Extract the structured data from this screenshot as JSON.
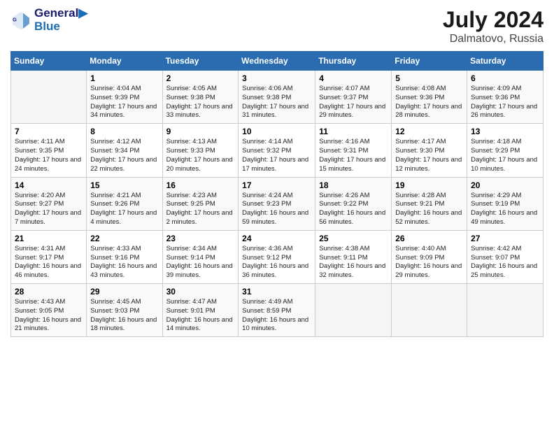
{
  "logo": {
    "line1": "General",
    "line2": "Blue"
  },
  "title": {
    "month_year": "July 2024",
    "location": "Dalmatovo, Russia"
  },
  "header_days": [
    "Sunday",
    "Monday",
    "Tuesday",
    "Wednesday",
    "Thursday",
    "Friday",
    "Saturday"
  ],
  "weeks": [
    [
      {
        "day": "",
        "info": ""
      },
      {
        "day": "1",
        "info": "Sunrise: 4:04 AM\nSunset: 9:39 PM\nDaylight: 17 hours and 34 minutes."
      },
      {
        "day": "2",
        "info": "Sunrise: 4:05 AM\nSunset: 9:38 PM\nDaylight: 17 hours and 33 minutes."
      },
      {
        "day": "3",
        "info": "Sunrise: 4:06 AM\nSunset: 9:38 PM\nDaylight: 17 hours and 31 minutes."
      },
      {
        "day": "4",
        "info": "Sunrise: 4:07 AM\nSunset: 9:37 PM\nDaylight: 17 hours and 29 minutes."
      },
      {
        "day": "5",
        "info": "Sunrise: 4:08 AM\nSunset: 9:36 PM\nDaylight: 17 hours and 28 minutes."
      },
      {
        "day": "6",
        "info": "Sunrise: 4:09 AM\nSunset: 9:36 PM\nDaylight: 17 hours and 26 minutes."
      }
    ],
    [
      {
        "day": "7",
        "info": "Sunrise: 4:11 AM\nSunset: 9:35 PM\nDaylight: 17 hours and 24 minutes."
      },
      {
        "day": "8",
        "info": "Sunrise: 4:12 AM\nSunset: 9:34 PM\nDaylight: 17 hours and 22 minutes."
      },
      {
        "day": "9",
        "info": "Sunrise: 4:13 AM\nSunset: 9:33 PM\nDaylight: 17 hours and 20 minutes."
      },
      {
        "day": "10",
        "info": "Sunrise: 4:14 AM\nSunset: 9:32 PM\nDaylight: 17 hours and 17 minutes."
      },
      {
        "day": "11",
        "info": "Sunrise: 4:16 AM\nSunset: 9:31 PM\nDaylight: 17 hours and 15 minutes."
      },
      {
        "day": "12",
        "info": "Sunrise: 4:17 AM\nSunset: 9:30 PM\nDaylight: 17 hours and 12 minutes."
      },
      {
        "day": "13",
        "info": "Sunrise: 4:18 AM\nSunset: 9:29 PM\nDaylight: 17 hours and 10 minutes."
      }
    ],
    [
      {
        "day": "14",
        "info": "Sunrise: 4:20 AM\nSunset: 9:27 PM\nDaylight: 17 hours and 7 minutes."
      },
      {
        "day": "15",
        "info": "Sunrise: 4:21 AM\nSunset: 9:26 PM\nDaylight: 17 hours and 4 minutes."
      },
      {
        "day": "16",
        "info": "Sunrise: 4:23 AM\nSunset: 9:25 PM\nDaylight: 17 hours and 2 minutes."
      },
      {
        "day": "17",
        "info": "Sunrise: 4:24 AM\nSunset: 9:23 PM\nDaylight: 16 hours and 59 minutes."
      },
      {
        "day": "18",
        "info": "Sunrise: 4:26 AM\nSunset: 9:22 PM\nDaylight: 16 hours and 56 minutes."
      },
      {
        "day": "19",
        "info": "Sunrise: 4:28 AM\nSunset: 9:21 PM\nDaylight: 16 hours and 52 minutes."
      },
      {
        "day": "20",
        "info": "Sunrise: 4:29 AM\nSunset: 9:19 PM\nDaylight: 16 hours and 49 minutes."
      }
    ],
    [
      {
        "day": "21",
        "info": "Sunrise: 4:31 AM\nSunset: 9:17 PM\nDaylight: 16 hours and 46 minutes."
      },
      {
        "day": "22",
        "info": "Sunrise: 4:33 AM\nSunset: 9:16 PM\nDaylight: 16 hours and 43 minutes."
      },
      {
        "day": "23",
        "info": "Sunrise: 4:34 AM\nSunset: 9:14 PM\nDaylight: 16 hours and 39 minutes."
      },
      {
        "day": "24",
        "info": "Sunrise: 4:36 AM\nSunset: 9:12 PM\nDaylight: 16 hours and 36 minutes."
      },
      {
        "day": "25",
        "info": "Sunrise: 4:38 AM\nSunset: 9:11 PM\nDaylight: 16 hours and 32 minutes."
      },
      {
        "day": "26",
        "info": "Sunrise: 4:40 AM\nSunset: 9:09 PM\nDaylight: 16 hours and 29 minutes."
      },
      {
        "day": "27",
        "info": "Sunrise: 4:42 AM\nSunset: 9:07 PM\nDaylight: 16 hours and 25 minutes."
      }
    ],
    [
      {
        "day": "28",
        "info": "Sunrise: 4:43 AM\nSunset: 9:05 PM\nDaylight: 16 hours and 21 minutes."
      },
      {
        "day": "29",
        "info": "Sunrise: 4:45 AM\nSunset: 9:03 PM\nDaylight: 16 hours and 18 minutes."
      },
      {
        "day": "30",
        "info": "Sunrise: 4:47 AM\nSunset: 9:01 PM\nDaylight: 16 hours and 14 minutes."
      },
      {
        "day": "31",
        "info": "Sunrise: 4:49 AM\nSunset: 8:59 PM\nDaylight: 16 hours and 10 minutes."
      },
      {
        "day": "",
        "info": ""
      },
      {
        "day": "",
        "info": ""
      },
      {
        "day": "",
        "info": ""
      }
    ]
  ]
}
